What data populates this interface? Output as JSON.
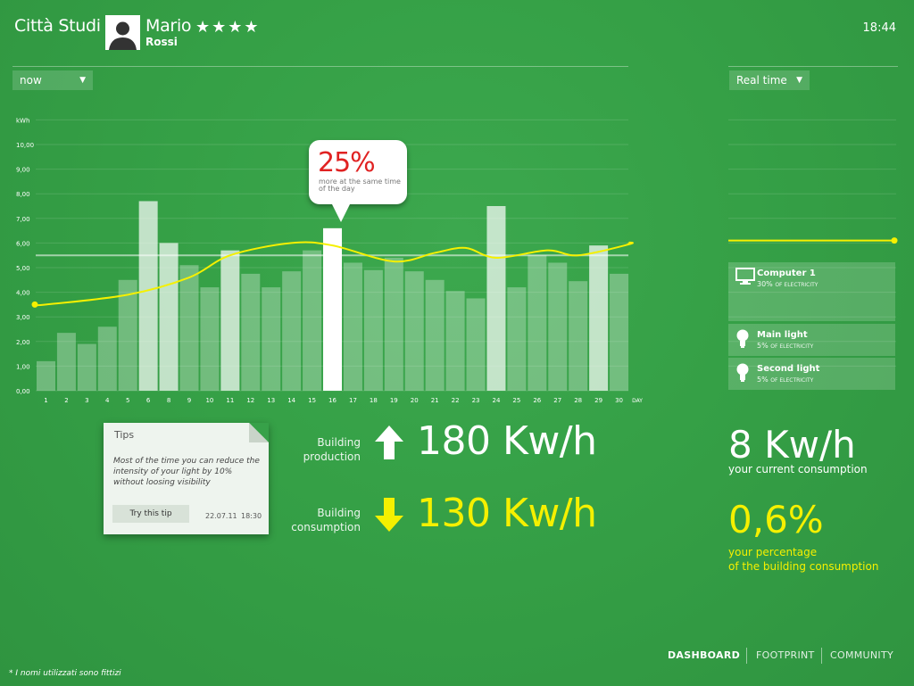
{
  "header": {
    "app_title": "Città Studi",
    "user_first": "Mario",
    "user_last": "Rossi",
    "user_stars": "★★★★",
    "clock": "18:44"
  },
  "controls": {
    "period_select": "now",
    "mode_select": "Real time"
  },
  "chart_data": {
    "type": "bar",
    "ylabel": "kWh",
    "xlabel": "DAY",
    "ylim": [
      0,
      11
    ],
    "y_ticks": [
      "0,00",
      "1,00",
      "2,00",
      "3,00",
      "4,00",
      "5,00",
      "6,00",
      "7,00",
      "8,00",
      "9,00",
      "10,00"
    ],
    "categories": [
      "1",
      "2",
      "3",
      "4",
      "5",
      "6",
      "8",
      "9",
      "10",
      "11",
      "12",
      "13",
      "14",
      "15",
      "16",
      "17",
      "18",
      "19",
      "20",
      "21",
      "22",
      "23",
      "24",
      "25",
      "26",
      "27",
      "28",
      "29",
      "30"
    ],
    "values": [
      1.2,
      2.35,
      1.9,
      2.6,
      4.5,
      7.7,
      6.0,
      5.1,
      4.2,
      5.7,
      4.75,
      4.2,
      4.85,
      5.7,
      6.6,
      5.2,
      4.9,
      5.4,
      4.85,
      4.5,
      4.05,
      3.75,
      7.5,
      4.2,
      5.5,
      5.2,
      4.45,
      5.9,
      4.75
    ],
    "highlighted": [
      5,
      6,
      9,
      14,
      22,
      27
    ],
    "selected": 14,
    "average": 5.5,
    "trend": [
      [
        0,
        3.5
      ],
      [
        4,
        3.9
      ],
      [
        7,
        4.6
      ],
      [
        9,
        5.5
      ],
      [
        12,
        6.0
      ],
      [
        14,
        5.9
      ],
      [
        17,
        5.25
      ],
      [
        19,
        5.6
      ],
      [
        20.5,
        5.8
      ],
      [
        22,
        5.4
      ],
      [
        24.5,
        5.7
      ],
      [
        26,
        5.5
      ],
      [
        28.5,
        5.95
      ]
    ],
    "grid": true,
    "callout": {
      "value": "25%",
      "text": "more at the same time of the day"
    }
  },
  "realtime": {
    "level": 6.1,
    "devices": [
      {
        "name": "Computer 1",
        "pct": "30%",
        "unit": "OF ELECTRICITY",
        "icon": "monitor-icon"
      },
      {
        "name": "Main light",
        "pct": "5%",
        "unit": "OF ELECTRICITY",
        "icon": "bulb-icon"
      },
      {
        "name": "Second light",
        "pct": "5%",
        "unit": "OF ELECTRICITY",
        "icon": "bulb-icon"
      }
    ]
  },
  "tips": {
    "title": "Tips",
    "body": "Most of the time you can reduce the intensity of your light by 10% without loosing visibility",
    "button": "Try this tip",
    "date": "22.07.11",
    "time": "18:30"
  },
  "building": {
    "production_label_1": "Building",
    "production_label_2": "production",
    "production_value": "180 Kw/h",
    "consumption_label_1": "Building",
    "consumption_label_2": "consumption",
    "consumption_value": "130 Kw/h"
  },
  "personal": {
    "current_value": "8 Kw/h",
    "current_label": "your current consumption",
    "pct_value": "0,6%",
    "pct_label_1": "your percentage",
    "pct_label_2": "of the building consumption"
  },
  "nav": {
    "dashboard": "DASHBOARD",
    "footprint": "FOOTPRINT",
    "community": "COMMUNITY"
  },
  "footnote": "* I nomi utilizzati sono fittizi",
  "colors": {
    "accent_yellow": "#f5f000",
    "alert_red": "#e02222",
    "background": "#35a046"
  }
}
